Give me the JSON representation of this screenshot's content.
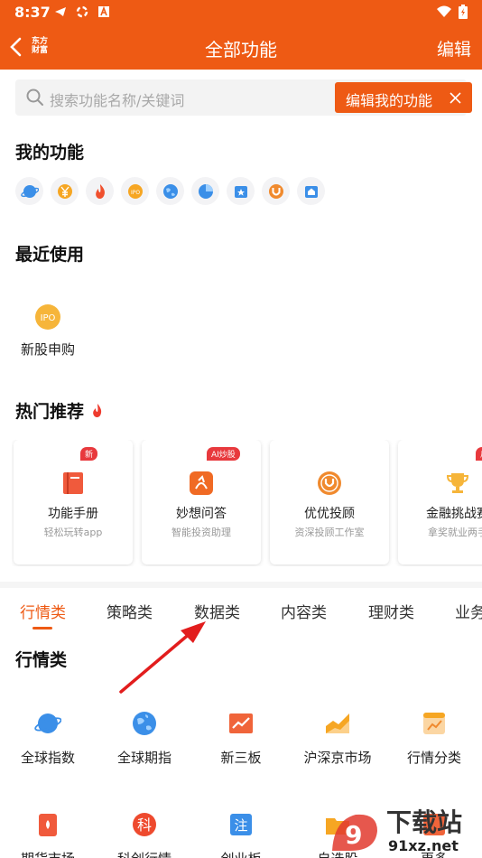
{
  "status_bar": {
    "time": "8:37"
  },
  "header": {
    "logo_line1": "东方",
    "logo_line2": "财富",
    "title": "全部功能",
    "edit_label": "编辑"
  },
  "search": {
    "placeholder": "搜索功能名称/关键词"
  },
  "tooltip": {
    "text": "编辑我的功能"
  },
  "my_functions": {
    "title": "我的功能",
    "icons": [
      "planet-icon",
      "yen-coin-icon",
      "flame-icon",
      "ipo-icon",
      "globe-icon",
      "pie-chart-icon",
      "star-card-icon",
      "u-logo-icon",
      "bank-icon"
    ]
  },
  "recent": {
    "title": "最近使用",
    "items": [
      {
        "label": "新股申购",
        "icon_text": "IPO"
      }
    ]
  },
  "hot": {
    "title": "热门推荐",
    "cards": [
      {
        "badge": "新",
        "title": "功能手册",
        "subtitle": "轻松玩转app"
      },
      {
        "badge": "AI炒股",
        "title": "妙想问答",
        "subtitle": "智能投资助理"
      },
      {
        "badge": "",
        "title": "优优投顾",
        "subtitle": "资深投顾工作室"
      },
      {
        "badge": "瓜分",
        "title": "金融挑战赛",
        "subtitle": "拿奖就业两手"
      }
    ]
  },
  "tabs": [
    "行情类",
    "策略类",
    "数据类",
    "内容类",
    "理财类",
    "业务"
  ],
  "market": {
    "title": "行情类",
    "row1": [
      "全球指数",
      "全球期指",
      "新三板",
      "沪深京市场",
      "行情分类"
    ],
    "row2": [
      "期货市场",
      "科创行情",
      "创业板",
      "自选股",
      "更多"
    ],
    "row2_icon_texts": [
      "",
      "科",
      "注",
      "",
      ""
    ]
  },
  "watermark": {
    "big": "下载站",
    "small": "91xz.net"
  },
  "colors": {
    "accent": "#ee5a14",
    "badge_red": "#e8393d",
    "icon_blue": "#3b8fe8"
  }
}
